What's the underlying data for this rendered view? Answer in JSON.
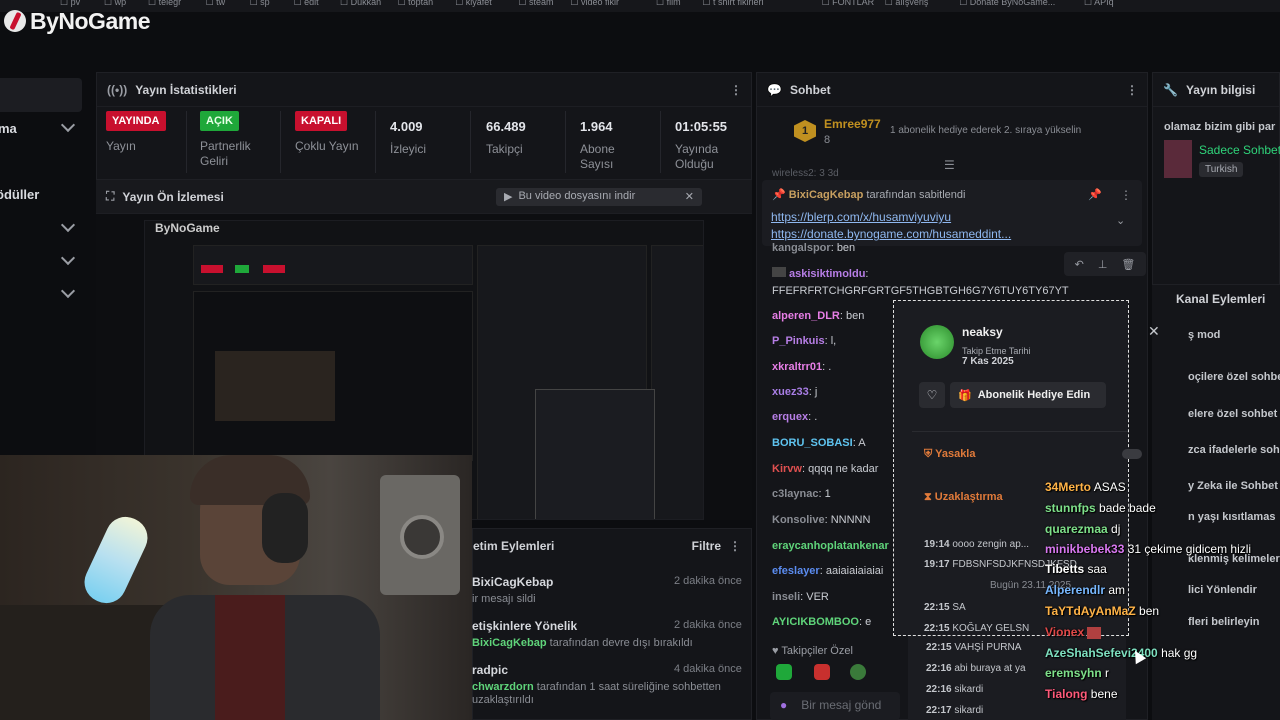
{
  "bookmarks": [
    "pv",
    "wp",
    "telegr",
    "tw",
    "sp",
    "edit",
    "Dukkan",
    "toptan",
    "kiyafet",
    "steam",
    "video fikir",
    "film",
    "t shirt fikirleri",
    "FONTLAR",
    "alışveriş",
    "Donate ByNoGame...",
    "APIq"
  ],
  "logo": {
    "text": "ByNoGame"
  },
  "leftnav": {
    "items": [
      {
        "label": "ma"
      },
      {
        "label": "ödüller"
      }
    ]
  },
  "stats_panel": {
    "title": "Yayın İstatistikleri",
    "items": [
      {
        "badge": "YAYINDA",
        "label": "Yayın",
        "badge_color": "#c8102e"
      },
      {
        "badge": "AÇIK",
        "label": "Partnerlik Geliri",
        "badge_color": "#1fa83a"
      },
      {
        "badge": "KAPALI",
        "label": "Çoklu Yayın",
        "badge_color": "#c8102e"
      },
      {
        "value": "4.009",
        "label": "İzleyici"
      },
      {
        "value": "66.489",
        "label": "Takipçi"
      },
      {
        "value": "1.964",
        "label": "Abone Sayısı"
      },
      {
        "value": "01:05:55",
        "label": "Yayında Olduğu"
      }
    ]
  },
  "preview_panel": {
    "title": "Yayın Ön İzlemesi",
    "download_label": "Bu video dosyasını indir"
  },
  "mod_panel": {
    "title": "etim Eylemleri",
    "filter_label": "Filtre",
    "items": [
      {
        "name": "BixiCagKebap",
        "time": "2 dakika önce",
        "desc": "ir mesajı sildi"
      },
      {
        "name": "etişkinlere Yönelik",
        "time": "2 dakika önce",
        "desc_user": "BixiCagKebap",
        "desc": "tarafından devre dışı bırakıldı"
      },
      {
        "name": "radpic",
        "time": "4 dakika önce",
        "desc_user": "chwarzdorn",
        "desc": "tarafından 1 saat süreliğine sohbetten"
      },
      {
        "name": "",
        "time": "",
        "desc": "uzaklaştırıldı"
      }
    ]
  },
  "chat": {
    "title": "Sohbet",
    "top_user": "Emree977",
    "top_user_count": "8",
    "top_user_msg": "1 abonelik hediye ederek 2. sıraya yükselin",
    "partial_top": "wireless2: 3 3d",
    "pinned": {
      "by": "BixiCagKebap",
      "suffix": "tarafından sabitlendi",
      "link1": "https://blerp.com/x/husamviyuviyu",
      "link2": "https://donate.bynogame.com/husameddint..."
    },
    "messages": [
      {
        "user": "kangalspor",
        "text": "ben",
        "color": "#8a8d94"
      },
      {
        "user": "askisiktimoldu",
        "text": "",
        "color": "#b77ee6"
      },
      {
        "user": "",
        "text": "FFEFRFRTCHGRFGRTGF5THGBTGH6G7Y6TUY6TY67YT",
        "color": "#c9ccd2"
      },
      {
        "user": "alperen_DLR",
        "text": "ben",
        "color": "#e77ee6"
      },
      {
        "user": "P_Pinkuis",
        "text": "l,",
        "color": "#b77ee6"
      },
      {
        "user": "xkraltrr01",
        "text": ".",
        "color": "#e77ee6"
      },
      {
        "user": "xuez33",
        "text": "j",
        "color": "#a97ee6"
      },
      {
        "user": "erquex",
        "text": ".",
        "color": "#b77ee6"
      },
      {
        "user": "BORU_SOBASI",
        "text": "A",
        "color": "#5fc4f0"
      },
      {
        "user": "Kirvw",
        "text": "qqqq ne kadar",
        "color": "#e05050"
      },
      {
        "user": "c3laynac",
        "text": "1",
        "color": "#8a8d94"
      },
      {
        "user": "Konsolive",
        "text": "NNNNN",
        "color": "#8a8d94"
      },
      {
        "user": "eraycanhoplatankenar",
        "text": "",
        "color": "#5fd47a"
      },
      {
        "user": "efeslayer",
        "text": "aaiaiaiaiaiai",
        "color": "#5b8cf0"
      },
      {
        "user": "inseli",
        "text": "VER",
        "color": "#8a8d94"
      },
      {
        "user": "AYICIKBOMBOO",
        "text": "e",
        "color": "#5fd47a"
      }
    ],
    "followers_label": "Takipçiler Özel",
    "input_placeholder": "Bir mesaj gönd"
  },
  "popup": {
    "username": "neaksy",
    "follow_label": "Takip Etme Tarihi",
    "follow_date": "7 Kas 2025",
    "gift_label": "Abonelik Hediye Edin",
    "ban_label": "Yasakla",
    "timeout_label": "Uzaklaştırma",
    "history": [
      {
        "time": "19:14",
        "text": "oooo zengin ap..."
      },
      {
        "time": "19:17",
        "text": "FDBSNFSDJKFNSDJKFSD"
      },
      {
        "time": "",
        "text": "Bugün 23.11.2025"
      },
      {
        "time": "22:15",
        "text": "SA"
      },
      {
        "time": "22:15",
        "text": "KOĞLAY GELSN"
      },
      {
        "time": "22:15",
        "text": "VAHŞİ PURNA"
      },
      {
        "time": "22:16",
        "text": "abi buraya at ya"
      },
      {
        "time": "22:16",
        "text": "sikardi"
      },
      {
        "time": "22:17",
        "text": "sikardi"
      }
    ]
  },
  "overlay_chat": [
    {
      "user": "34Merto",
      "text": "ASAS",
      "color": "#ffb347"
    },
    {
      "user": "stunnfps",
      "text": "bade bade",
      "color": "#7ee08a"
    },
    {
      "user": "quarezmaa",
      "text": "dj",
      "color": "#7ee08a"
    },
    {
      "user": "minikbebek33",
      "text": "31 çekime gidicem hizli",
      "color": "#d878f0"
    },
    {
      "user": "Tibetts",
      "text": "saa",
      "color": "#ffffff"
    },
    {
      "user": "Alperendlr",
      "text": "am",
      "color": "#78b8ff"
    },
    {
      "user": "TaYTdAyAnMaZ",
      "text": "ben",
      "color": "#ffb347"
    },
    {
      "user": "Vionex",
      "text": "",
      "color": "#e04848"
    },
    {
      "user": "AzeShahSefevi2400",
      "text": "hak gg",
      "color": "#7ee0c0"
    },
    {
      "user": "eremsyhn",
      "text": "r",
      "color": "#7ee08a"
    },
    {
      "user": "Tialong",
      "text": "bene",
      "color": "#ff5a7a"
    }
  ],
  "right_panel": {
    "title": "Yayın bilgisi",
    "stream_title": "olamaz bizim gibi par",
    "category": "Sadece Sohbet",
    "language": "Turkish",
    "actions_title": "Kanal Eylemleri",
    "actions": [
      "ş mod",
      "oçilere özel sohbet",
      "elere özel sohbet",
      "zca ifadelerle sohb",
      "y Zeka ile Sohbet",
      "n yaşı kısıtlamas",
      "klenmiş kelimeler",
      "lici Yönlendir",
      "fleri belirleyin"
    ]
  }
}
